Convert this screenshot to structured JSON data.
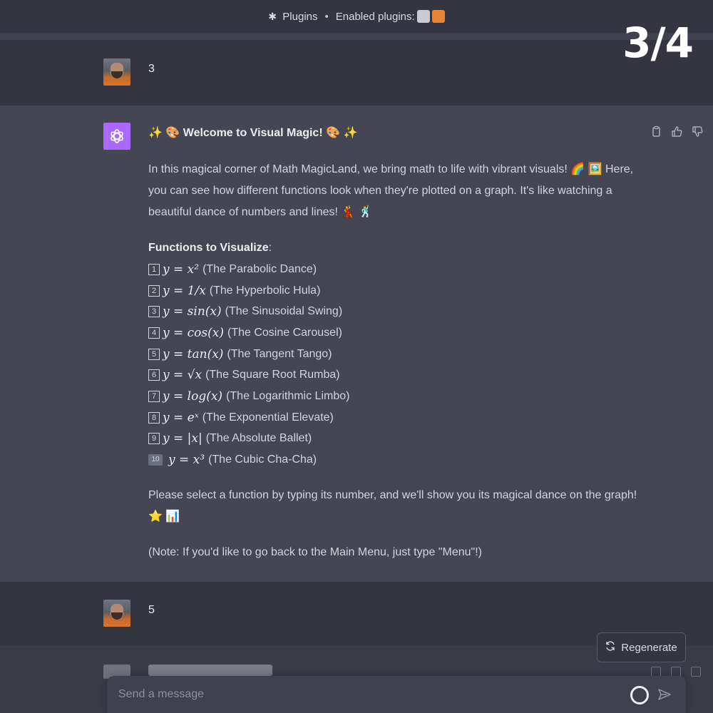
{
  "header": {
    "plugins_label": "Plugins",
    "separator": "•",
    "enabled_label": "Enabled plugins:"
  },
  "counter": "3/4",
  "conversation": {
    "user_msg_1": "3",
    "assistant": {
      "title": "Welcome to Visual Magic!",
      "intro": "In this magical corner of Math MagicLand, we bring math to life with vibrant visuals! 🌈 🖼️ Here, you can see how different functions look when they're plotted on a graph. It's like watching a beautiful dance of numbers and lines! 💃 🕺",
      "functions_heading": "Functions to Visualize",
      "functions": [
        {
          "num": "1",
          "math": "y = x²",
          "label": "(The Parabolic Dance)"
        },
        {
          "num": "2",
          "math": "y = 1/x",
          "label": "(The Hyperbolic Hula)"
        },
        {
          "num": "3",
          "math": "y = sin(x)",
          "label": "(The Sinusoidal Swing)"
        },
        {
          "num": "4",
          "math": "y = cos(x)",
          "label": "(The Cosine Carousel)"
        },
        {
          "num": "5",
          "math": "y = tan(x)",
          "label": "(The Tangent Tango)"
        },
        {
          "num": "6",
          "math": "y = √x",
          "label": "(The Square Root Rumba)"
        },
        {
          "num": "7",
          "math": "y = log(x)",
          "label": "(The Logarithmic Limbo)"
        },
        {
          "num": "8",
          "math": "y = eˣ",
          "label": "(The Exponential Elevate)"
        },
        {
          "num": "9",
          "math": "y = |x|",
          "label": "(The Absolute Ballet)"
        },
        {
          "num": "10",
          "math": "y = x³",
          "label": "(The Cubic Cha-Cha)"
        }
      ],
      "prompt": "Please select a function by typing its number, and we'll show you its magical dance on the graph! ⭐ 📊",
      "note": "(Note: If you'd like to go back to the Main Menu, just type \"Menu\"!)"
    },
    "user_msg_2": "5"
  },
  "regenerate_label": "Regenerate",
  "input": {
    "placeholder": "Send a message"
  },
  "colors": {
    "user_row": "#343541",
    "assistant_row": "#444654",
    "gpt_logo": "#ab68ff"
  }
}
